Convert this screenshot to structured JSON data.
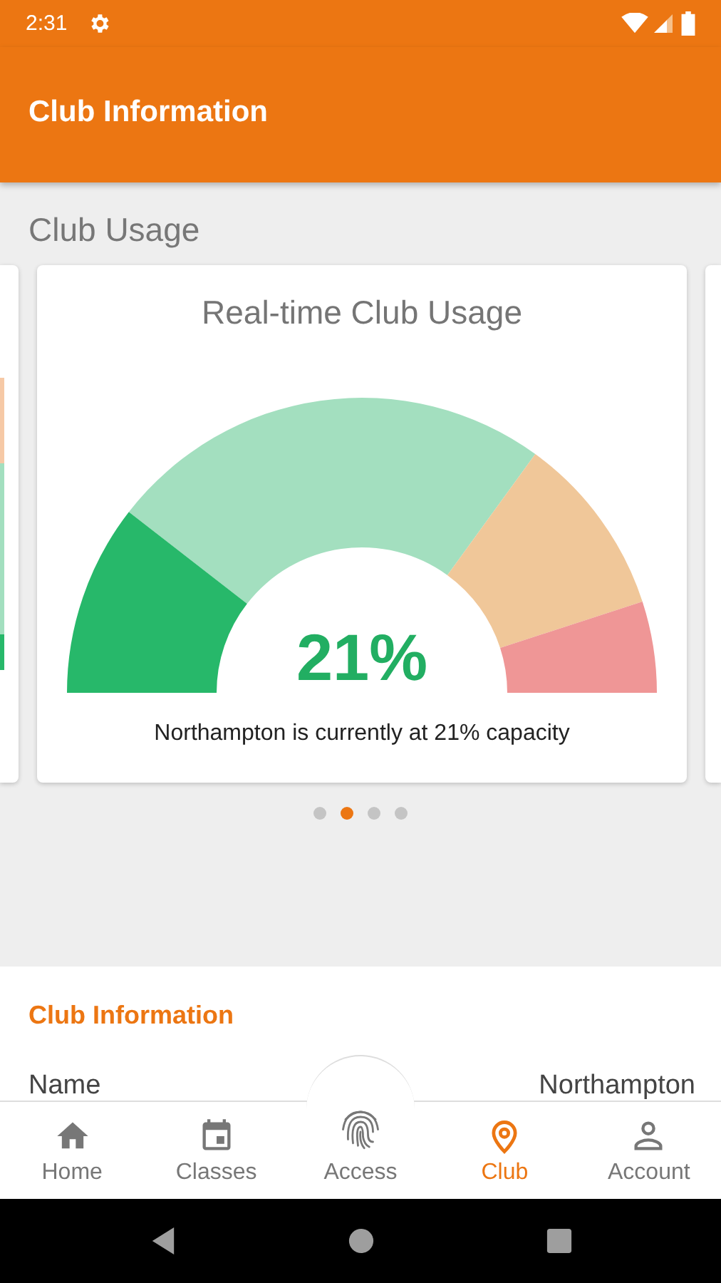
{
  "status_bar": {
    "time": "2:31"
  },
  "app_bar": {
    "title": "Club Information"
  },
  "usage": {
    "heading": "Club Usage",
    "card": {
      "title": "Real-time Club Usage",
      "gauge": {
        "level": 0.21,
        "reading": "21%"
      },
      "caption": "Northampton is currently at 21% capacity"
    },
    "pager": [
      {
        "selected": false
      },
      {
        "selected": true
      },
      {
        "selected": false
      },
      {
        "selected": false
      }
    ]
  },
  "info": {
    "heading": "Club Information",
    "rows": [
      {
        "label": "Name",
        "value": "Northampton"
      }
    ]
  },
  "nav": {
    "tabs": [
      {
        "kind": "home",
        "label": "Home",
        "selected": false
      },
      {
        "kind": "classes",
        "label": "Classes",
        "selected": false
      },
      {
        "kind": "center",
        "label": "Access",
        "selected": false
      },
      {
        "kind": "club",
        "label": "Club",
        "selected": true
      },
      {
        "kind": "account",
        "label": "Account",
        "selected": false
      }
    ]
  }
}
